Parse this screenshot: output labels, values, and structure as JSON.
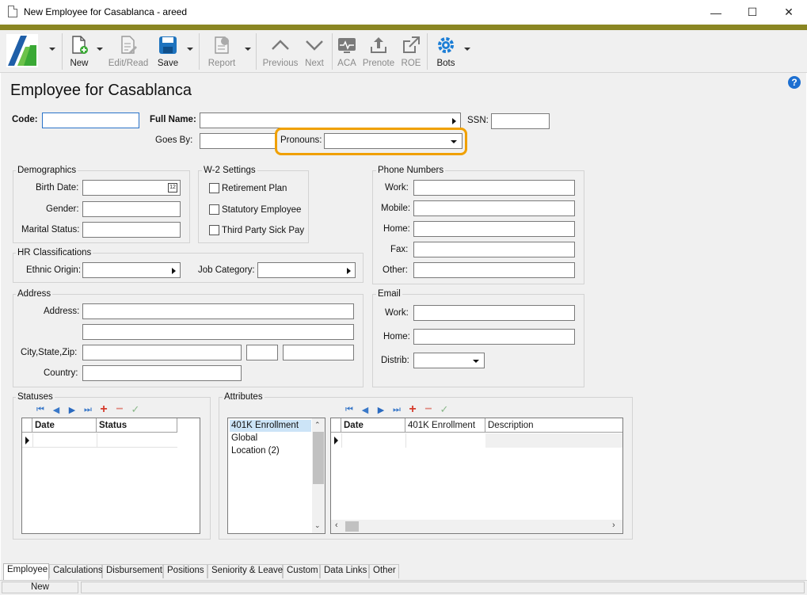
{
  "window": {
    "title": "New Employee for Casablanca - areed",
    "minimize": "—",
    "maximize": "☐",
    "close": "✕"
  },
  "toolbar": {
    "new": "New",
    "edit_read": "Edit/Read",
    "save": "Save",
    "report": "Report",
    "previous": "Previous",
    "next": "Next",
    "aca": "ACA",
    "prenote": "Prenote",
    "roe": "ROE",
    "bots": "Bots"
  },
  "page": {
    "title": "Employee for Casablanca",
    "help": "?"
  },
  "header_fields": {
    "code_label": "Code:",
    "code_value": "",
    "full_name_label": "Full Name:",
    "full_name_value": "",
    "ssn_label": "SSN:",
    "ssn_value": "",
    "goes_by_label": "Goes By:",
    "goes_by_value": "",
    "pronouns_label": "Pronouns:",
    "pronouns_value": ""
  },
  "demographics": {
    "title": "Demographics",
    "birth_date_label": "Birth Date:",
    "birth_date_value": "",
    "gender_label": "Gender:",
    "gender_value": "",
    "marital_label": "Marital Status:",
    "marital_value": ""
  },
  "w2": {
    "title": "W-2 Settings",
    "retirement": "Retirement Plan",
    "statutory": "Statutory Employee",
    "third_party": "Third Party Sick Pay"
  },
  "hr": {
    "title": "HR Classifications",
    "ethnic_label": "Ethnic Origin:",
    "ethnic_value": "",
    "job_label": "Job Category:",
    "job_value": ""
  },
  "phone": {
    "title": "Phone Numbers",
    "work_label": "Work:",
    "mobile_label": "Mobile:",
    "home_label": "Home:",
    "fax_label": "Fax:",
    "other_label": "Other:"
  },
  "address": {
    "title": "Address",
    "address_label": "Address:",
    "city_label": "City,State,Zip:",
    "country_label": "Country:"
  },
  "email": {
    "title": "Email",
    "work_label": "Work:",
    "home_label": "Home:",
    "distrib_label": "Distrib:"
  },
  "statuses": {
    "title": "Statuses",
    "columns": [
      "Date",
      "Status"
    ]
  },
  "attributes": {
    "title": "Attributes",
    "list": [
      "401K Enrollment",
      "Global",
      "Location (2)"
    ],
    "columns": [
      "Date",
      "401K Enrollment",
      "Description"
    ]
  },
  "tabs": [
    "Employee",
    "Calculations",
    "Disbursement",
    "Positions",
    "Seniority & Leave",
    "Custom",
    "Data Links",
    "Other"
  ],
  "status_bar": {
    "mode": "New"
  },
  "colors": {
    "accent_bar": "#8a8623",
    "highlight": "#f0a000",
    "logo_green": "#3aa935",
    "logo_blue": "#1f5fa8",
    "save_blue": "#1e73be",
    "bots_blue": "#1c7ed6"
  }
}
